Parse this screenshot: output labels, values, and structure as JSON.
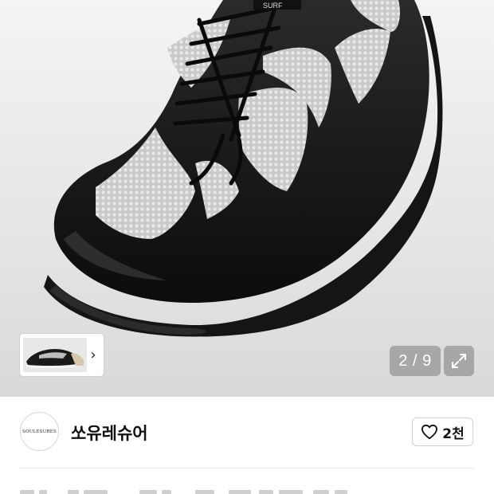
{
  "gallery": {
    "current_page": "2",
    "separator": "/",
    "total_pages": "9",
    "indicator_text": "2 / 9",
    "next_arrow": "›",
    "expand_icon": "expand-icon"
  },
  "shoe_logo_text": "SURF",
  "store": {
    "logo_text": "SOULESURES",
    "name": "쏘유레슈어",
    "likes": "2천",
    "like_icon": "heart-outline-icon"
  },
  "colors": {
    "hero_background": "#e4e4e4",
    "overlay_button": "#969696",
    "text": "#111111",
    "divider": "#e6e6e6"
  }
}
